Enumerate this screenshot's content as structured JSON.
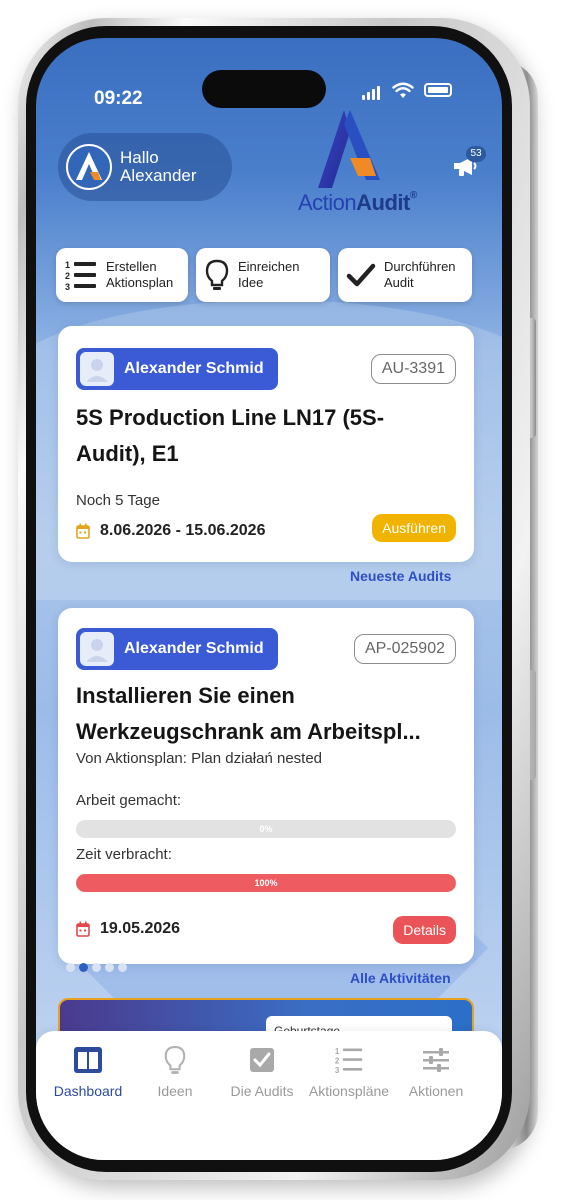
{
  "status_bar": {
    "time": "09:22"
  },
  "header": {
    "greeting_line1": "Hallo",
    "greeting_line2": "Alexander",
    "brand_part1": "Action",
    "brand_part2": "Audit",
    "brand_reg": "®",
    "notification_count": "53"
  },
  "quick_actions": [
    {
      "label_line1": "Erstellen",
      "label_line2": "Aktionsplan",
      "icon": "numbered-list-icon"
    },
    {
      "label_line1": "Einreichen",
      "label_line2": "Idee",
      "icon": "lightbulb-icon"
    },
    {
      "label_line1": "Durchführen",
      "label_line2": "Audit",
      "icon": "checkmark-icon"
    }
  ],
  "audit_card": {
    "user": "Alexander Schmid",
    "id": "AU-3391",
    "title_line1": "5S Production Line LN17 (5S-",
    "title_line2": "Audit), E1",
    "remaining": "Noch 5 Tage",
    "date_range": "8.06.2026 - 15.06.2026",
    "button": "Ausführen",
    "button_color": "#f0b400"
  },
  "audits_link": "Neueste Audits",
  "action_card": {
    "user": "Alexander Schmid",
    "id": "AP-025902",
    "title_line1": "Installieren Sie einen",
    "title_line2": "Werkzeugschrank am Arbeitspl...",
    "subtitle": "Von Aktionsplan: Plan działań nested",
    "work_label": "Arbeit gemacht:",
    "work_pct_text": "0%",
    "work_fraction": 0,
    "time_label": "Zeit verbracht:",
    "time_pct_text": "100%",
    "time_fraction": 1,
    "date": "19.05.2026",
    "button": "Details",
    "button_color": "#ea5458"
  },
  "activities_link": "Alle Aktivitäten",
  "carousel": {
    "count": 5,
    "active_index": 1
  },
  "peek_card": {
    "text": "Geburtstage"
  },
  "tabbar": [
    {
      "label": "Dashboard",
      "icon": "dashboard-icon",
      "active": true
    },
    {
      "label": "Ideen",
      "icon": "lightbulb-icon",
      "active": false
    },
    {
      "label": "Die Audits",
      "icon": "checkbox-icon",
      "active": false
    },
    {
      "label": "Aktionspläne",
      "icon": "numbered-list-icon",
      "active": false
    },
    {
      "label": "Aktionen",
      "icon": "sliders-icon",
      "active": false
    }
  ],
  "colors": {
    "accent": "#3b5bd6",
    "link": "#2e4fc4",
    "tab_active": "#2c4b9b",
    "tab_inactive": "#9a9a9a"
  }
}
